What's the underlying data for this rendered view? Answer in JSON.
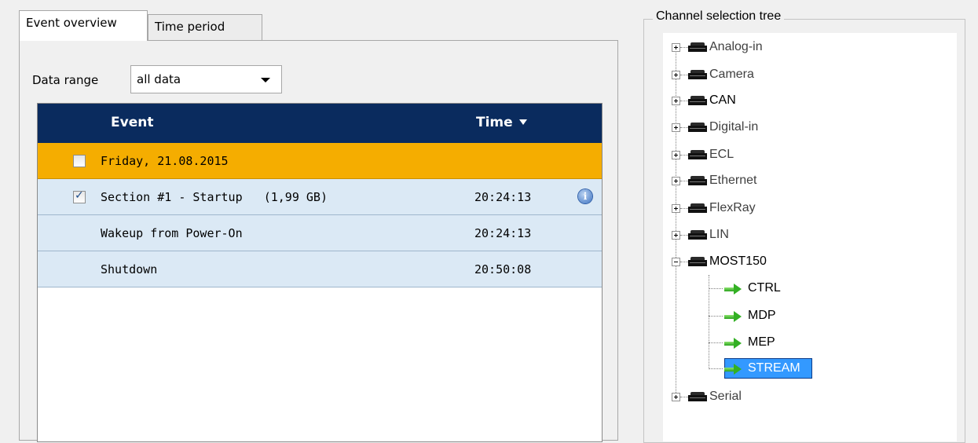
{
  "tabs": [
    {
      "label": "Event overview",
      "active": true
    },
    {
      "label": "Time period",
      "active": false
    }
  ],
  "data_range": {
    "label": "Data range",
    "value": "all data"
  },
  "table": {
    "columns": {
      "event": "Event",
      "time": "Time"
    },
    "sort_icon": "sort-desc-triangle",
    "date_group": {
      "label": "Friday, 21.08.2015",
      "checked": false,
      "color": "#f5ad00"
    },
    "rows": [
      {
        "event": "Section #1 - Startup   (1,99 GB)",
        "time": "20:24:13",
        "checkbox": true,
        "checked": true,
        "info_icon": true
      },
      {
        "event": "Wakeup from Power-On",
        "time": "20:24:13"
      },
      {
        "event": "Shutdown",
        "time": "20:50:08"
      }
    ],
    "header_color": "#0a2b5e",
    "row_color": "#dbe9f5"
  },
  "tree": {
    "title": "Channel selection tree",
    "nodes": [
      {
        "label": "Analog-in",
        "expanded": false,
        "muted": true
      },
      {
        "label": "Camera",
        "expanded": false,
        "muted": true
      },
      {
        "label": "CAN",
        "expanded": false,
        "muted": false
      },
      {
        "label": "Digital-in",
        "expanded": false,
        "muted": true
      },
      {
        "label": "ECL",
        "expanded": false,
        "muted": true
      },
      {
        "label": "Ethernet",
        "expanded": false,
        "muted": true
      },
      {
        "label": "FlexRay",
        "expanded": false,
        "muted": true
      },
      {
        "label": "LIN",
        "expanded": false,
        "muted": true
      },
      {
        "label": "MOST150",
        "expanded": true,
        "muted": false,
        "children": [
          {
            "label": "CTRL"
          },
          {
            "label": "MDP"
          },
          {
            "label": "MEP"
          },
          {
            "label": "STREAM",
            "selected": true
          }
        ]
      },
      {
        "label": "Serial",
        "expanded": false,
        "muted": true
      }
    ],
    "selection_color": "#3399ff"
  }
}
